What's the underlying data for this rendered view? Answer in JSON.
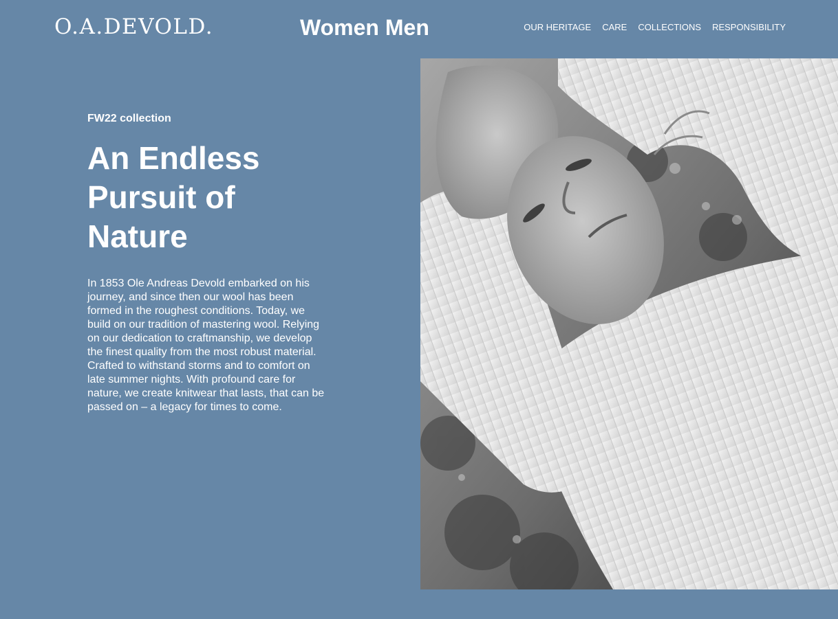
{
  "header": {
    "logo": "O.A.DEVOLD.",
    "gender_nav": [
      {
        "label": "Women"
      },
      {
        "label": "Men"
      }
    ],
    "menu": [
      {
        "label": "OUR HERITAGE"
      },
      {
        "label": "CARE"
      },
      {
        "label": "COLLECTIONS"
      },
      {
        "label": "RESPONSIBILITY"
      }
    ]
  },
  "hero": {
    "eyebrow": "FW22 collection",
    "headline_lines": [
      "An Endless",
      "Pursuit of",
      "Nature"
    ],
    "body": "In 1853 Ole Andreas Devold embarked on his journey, and since then our wool has been formed in the roughest conditions. Today, we build on our tradition of mastering wool. Relying on our dedication to craftmanship, we develop the finest quality from the most robust material. Crafted to withstand storms and to comfort on late summer nights. With profound care for nature, we create knitwear that lasts, that can be passed on – a legacy for times to come.",
    "image_icon": "photo-woman-in-white-knit-sweater-icon"
  },
  "colors": {
    "background": "#6687a7",
    "text": "#ffffff"
  }
}
